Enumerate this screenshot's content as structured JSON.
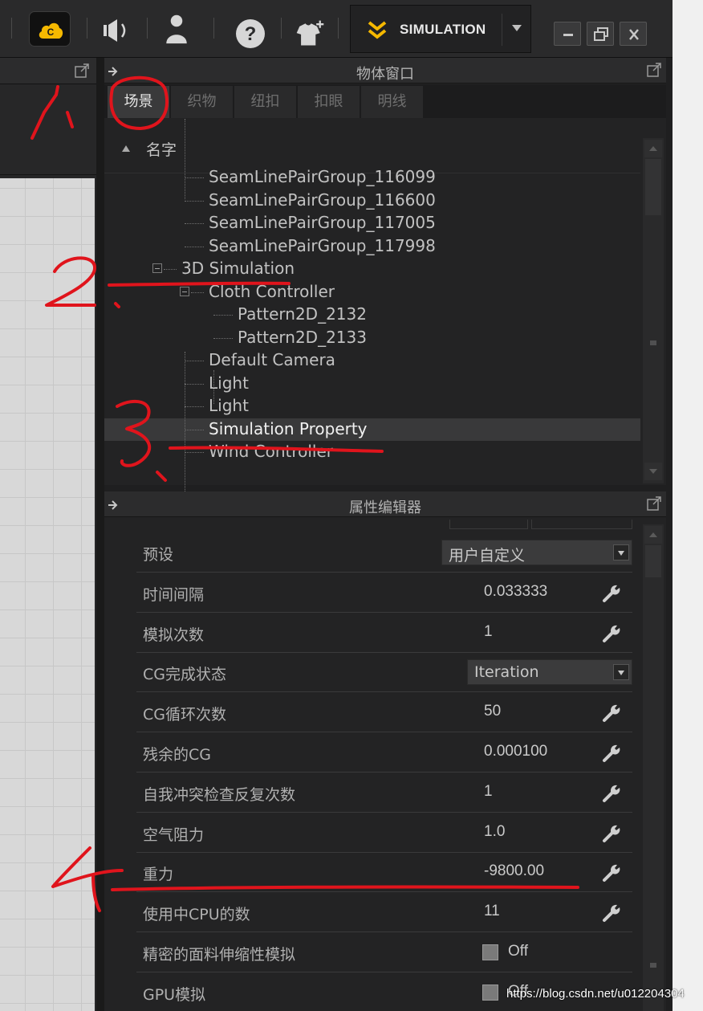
{
  "toolbar": {
    "mode_label": "SIMULATION",
    "icons": [
      "cloud-icon",
      "speaker-icon",
      "user-icon",
      "help-icon",
      "add-garment-icon"
    ]
  },
  "object_window": {
    "title": "物体窗口",
    "tabs": [
      "场景",
      "织物",
      "纽扣",
      "扣眼",
      "明线"
    ],
    "active_tab": "场景",
    "column_header": "名字",
    "tree": [
      {
        "label": "SeamLinePairGroup_116099",
        "depth": 2
      },
      {
        "label": "SeamLinePairGroup_116600",
        "depth": 2
      },
      {
        "label": "SeamLinePairGroup_117005",
        "depth": 2
      },
      {
        "label": "SeamLinePairGroup_117998",
        "depth": 2
      },
      {
        "label": "3D Simulation",
        "depth": 1,
        "expanded": true
      },
      {
        "label": "Cloth Controller",
        "depth": 2,
        "expanded": true
      },
      {
        "label": "Pattern2D_2132",
        "depth": 3
      },
      {
        "label": "Pattern2D_2133",
        "depth": 3
      },
      {
        "label": "Default Camera",
        "depth": 2
      },
      {
        "label": "Light",
        "depth": 2
      },
      {
        "label": "Light",
        "depth": 2
      },
      {
        "label": "Simulation Property",
        "depth": 2,
        "selected": true
      },
      {
        "label": "Wind Controller",
        "depth": 2
      }
    ]
  },
  "property_editor": {
    "title": "属性编辑器",
    "rows": [
      {
        "label": "预设",
        "type": "select",
        "value": "用户自定义"
      },
      {
        "label": "时间间隔",
        "type": "number",
        "value": "0.033333"
      },
      {
        "label": "模拟次数",
        "type": "number",
        "value": "1"
      },
      {
        "label": "CG完成状态",
        "type": "select",
        "value": "Iteration"
      },
      {
        "label": "CG循环次数",
        "type": "number",
        "value": "50"
      },
      {
        "label": "残余的CG",
        "type": "number",
        "value": "0.000100"
      },
      {
        "label": "自我冲突检查反复次数",
        "type": "number",
        "value": "1"
      },
      {
        "label": "空气阻力",
        "type": "number",
        "value": "1.0"
      },
      {
        "label": "重力",
        "type": "number",
        "value": "-9800.00"
      },
      {
        "label": "使用中CPU的数",
        "type": "number",
        "value": "11"
      },
      {
        "label": "精密的面料伸缩性模拟",
        "type": "checkbox",
        "value": "Off"
      },
      {
        "label": "GPU模拟",
        "type": "checkbox",
        "value": "Off"
      }
    ]
  },
  "annotations": [
    "1.",
    "2.",
    "3.",
    "4."
  ],
  "watermark": "https://blog.csdn.net/u012204304",
  "colors": {
    "annotation": "#e0141c",
    "accent": "#f5b800",
    "background": "#232324"
  }
}
